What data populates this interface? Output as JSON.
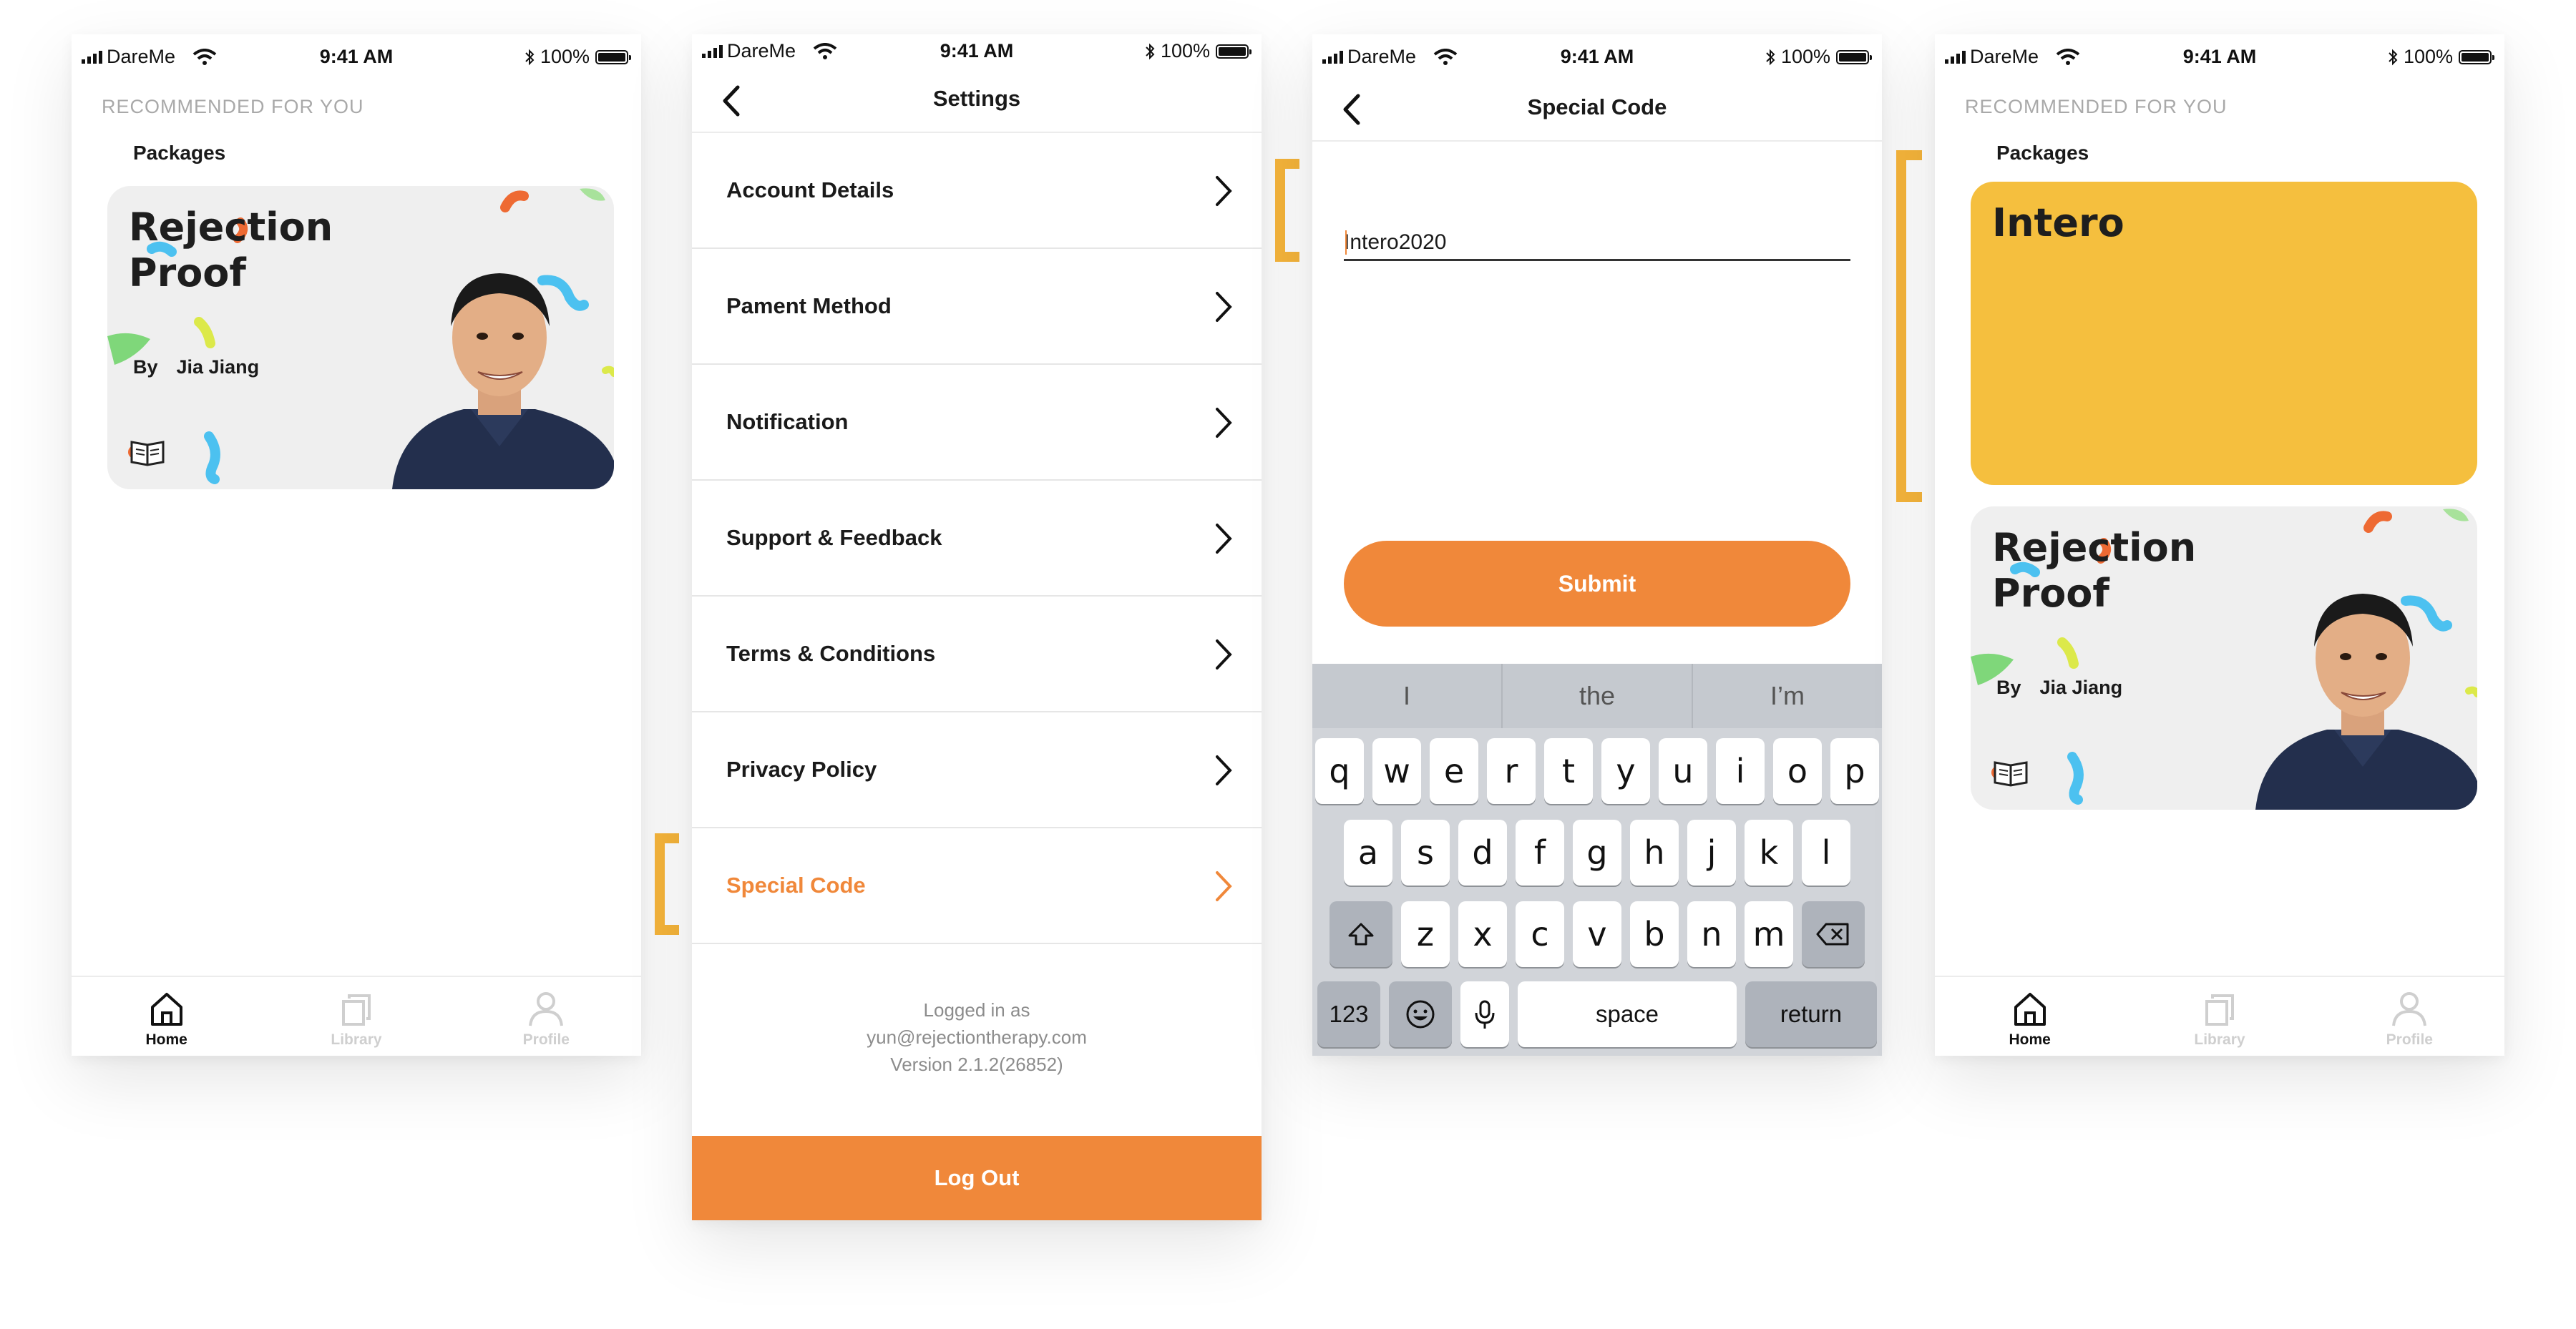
{
  "status_bar": {
    "carrier": "DareMe",
    "time": "9:41 AM",
    "battery": "100%"
  },
  "screen1": {
    "section_label": "RECOMMENDED FOR YOU",
    "sub_label": "Packages",
    "card": {
      "title_line1": "Rejection",
      "title_line2": "Proof",
      "by": "By",
      "author": "Jia Jiang"
    },
    "tabs": [
      {
        "label": "Home",
        "icon": "home-icon"
      },
      {
        "label": "Library",
        "icon": "library-icon"
      },
      {
        "label": "Profile",
        "icon": "profile-icon"
      }
    ]
  },
  "screen2": {
    "title": "Settings",
    "items": [
      {
        "label": "Account Details"
      },
      {
        "label": "Pament Method"
      },
      {
        "label": "Notification"
      },
      {
        "label": "Support & Feedback"
      },
      {
        "label": "Terms & Conditions"
      },
      {
        "label": "Privacy Policy"
      },
      {
        "label": "Special Code"
      }
    ],
    "footer": {
      "line1": "Logged in as",
      "line2": "yun@rejectiontherapy.com",
      "line3": "Version 2.1.2(26852)"
    },
    "logout_label": "Log Out"
  },
  "screen3": {
    "title": "Special Code",
    "input_value": "Intero2020",
    "submit_label": "Submit",
    "suggestions": [
      "I",
      "the",
      "I’m"
    ],
    "keyboard": {
      "row1": [
        "q",
        "w",
        "e",
        "r",
        "t",
        "y",
        "u",
        "i",
        "o",
        "p"
      ],
      "row2": [
        "a",
        "s",
        "d",
        "f",
        "g",
        "h",
        "j",
        "k",
        "l"
      ],
      "row3": [
        "z",
        "x",
        "c",
        "v",
        "b",
        "n",
        "m"
      ],
      "numbers_label": "123",
      "space_label": "space",
      "return_label": "return"
    }
  },
  "screen4": {
    "section_label": "RECOMMENDED FOR YOU",
    "sub_label": "Packages",
    "intero_title": "Intero",
    "card": {
      "title_line1": "Rejection",
      "title_line2": "Proof",
      "by": "By",
      "author": "Jia Jiang"
    },
    "tabs": [
      {
        "label": "Home",
        "icon": "home-icon"
      },
      {
        "label": "Library",
        "icon": "library-icon"
      },
      {
        "label": "Profile",
        "icon": "profile-icon"
      }
    ]
  },
  "colors": {
    "accent": "#f0883a",
    "highlight_bracket": "#f2b23a",
    "intero_card": "#f5bf3e"
  }
}
